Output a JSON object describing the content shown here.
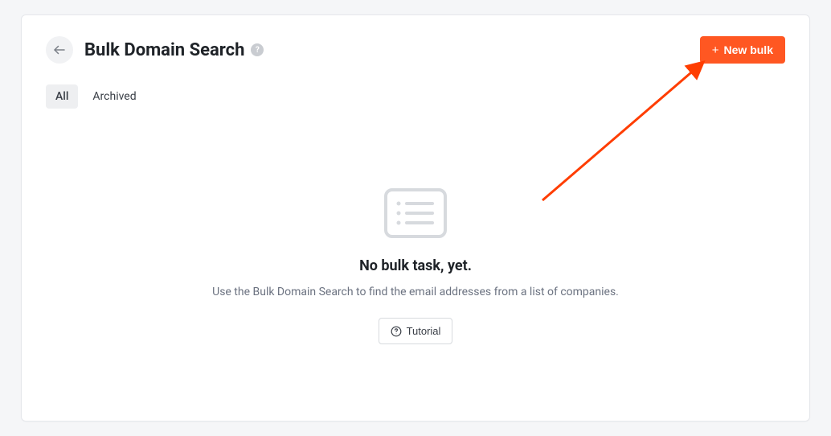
{
  "header": {
    "title": "Bulk Domain Search",
    "help_glyph": "?",
    "new_bulk_label": "New bulk"
  },
  "tabs": [
    {
      "label": "All",
      "active": true
    },
    {
      "label": "Archived",
      "active": false
    }
  ],
  "empty": {
    "title": "No bulk task, yet.",
    "subtitle": "Use the Bulk Domain Search to find the email addresses from a list of companies.",
    "tutorial_label": "Tutorial"
  },
  "colors": {
    "accent": "#ff5722",
    "annotation": "#ff3d00"
  }
}
